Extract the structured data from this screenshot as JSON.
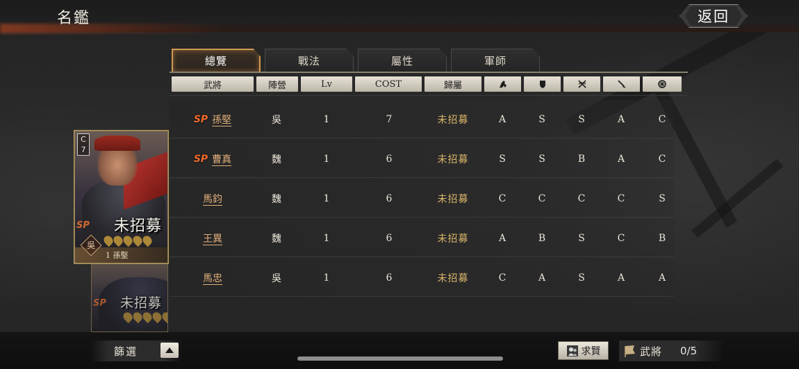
{
  "header": {
    "title": "名鑑",
    "back_label": "返回"
  },
  "tabs": [
    {
      "label": "總覽",
      "active": true
    },
    {
      "label": "戰法",
      "active": false
    },
    {
      "label": "屬性",
      "active": false
    },
    {
      "label": "軍師",
      "active": false
    }
  ],
  "columns": [
    {
      "label": "武將"
    },
    {
      "label": "陣營"
    },
    {
      "label": "Lv"
    },
    {
      "label": "COST"
    },
    {
      "label": "歸屬"
    },
    {
      "icon": "cavalry-icon"
    },
    {
      "icon": "shield-icon"
    },
    {
      "icon": "crossbow-icon"
    },
    {
      "icon": "spear-icon"
    },
    {
      "icon": "wheel-icon"
    }
  ],
  "rows": [
    {
      "sp": "SP",
      "name": "孫堅",
      "faction": "吳",
      "lv": "1",
      "cost": "7",
      "status": "未招募",
      "ranks": [
        "A",
        "S",
        "S",
        "A",
        "C"
      ]
    },
    {
      "sp": "SP",
      "name": "曹真",
      "faction": "魏",
      "lv": "1",
      "cost": "6",
      "status": "未招募",
      "ranks": [
        "S",
        "S",
        "B",
        "A",
        "C"
      ]
    },
    {
      "sp": "",
      "name": "馬鈞",
      "faction": "魏",
      "lv": "1",
      "cost": "6",
      "status": "未招募",
      "ranks": [
        "C",
        "C",
        "C",
        "C",
        "S"
      ]
    },
    {
      "sp": "",
      "name": "王異",
      "faction": "魏",
      "lv": "1",
      "cost": "6",
      "status": "未招募",
      "ranks": [
        "A",
        "B",
        "S",
        "C",
        "B"
      ]
    },
    {
      "sp": "",
      "name": "馬忠",
      "faction": "吳",
      "lv": "1",
      "cost": "6",
      "status": "未招募",
      "ranks": [
        "C",
        "A",
        "S",
        "A",
        "A"
      ]
    }
  ],
  "cards": [
    {
      "cost_letter": "C",
      "cost_value": "7",
      "sp": "SP",
      "status": "未招募",
      "faction": "吳",
      "footer": "1 孫堅"
    },
    {
      "sp": "SP",
      "status": "未招募"
    }
  ],
  "bottom": {
    "filter_label": "篩選",
    "recruit_label": "求賢",
    "general_label": "武將",
    "general_count": "0/5"
  },
  "colors": {
    "accent": "#d29a52",
    "name_link": "#e2b07c",
    "status": "#d8b46a",
    "sp": "#ee6a2a"
  }
}
